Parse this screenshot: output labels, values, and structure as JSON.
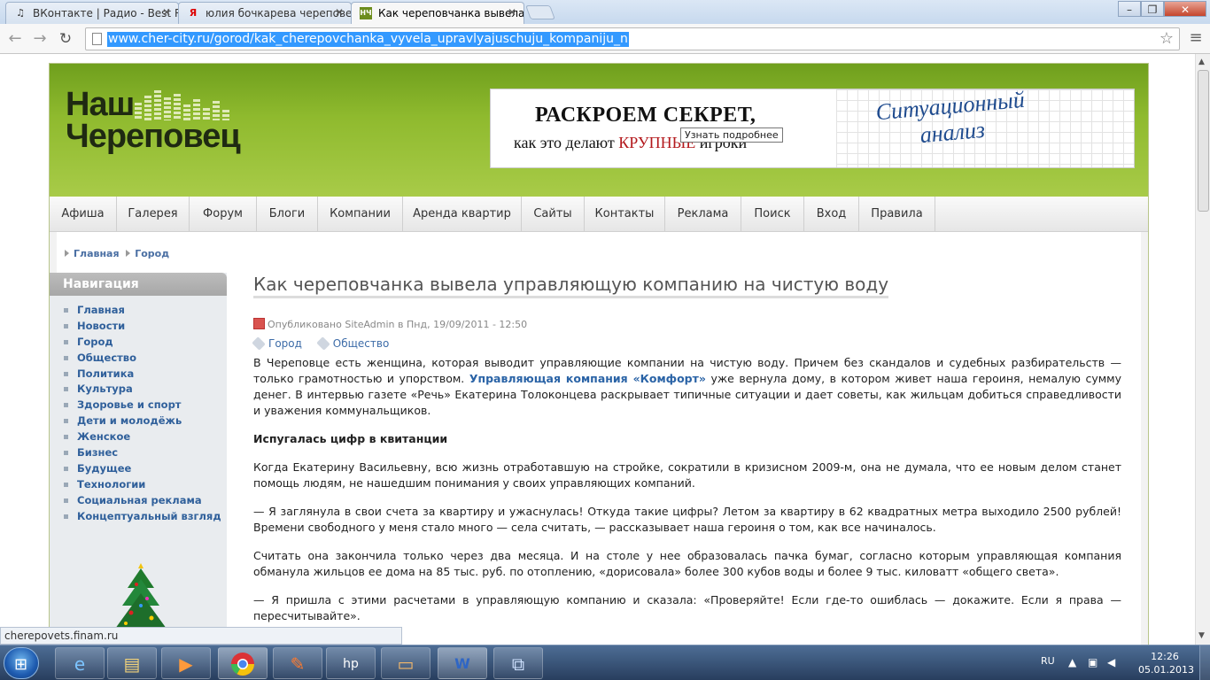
{
  "browser": {
    "tabs": [
      {
        "title": "ВКонтакте | Радио - Best Radio",
        "icon": "music-note-icon",
        "active": false
      },
      {
        "title": "юлия бочкарева череповец",
        "icon": "yandex-icon",
        "active": false
      },
      {
        "title": "Как череповчанка вывела управляющую",
        "icon": "site-favicon",
        "active": true
      }
    ],
    "url": "www.cher-city.ru/gorod/kak_cherepovchanka_vyvela_upravlyajuschuju_kompaniju_n",
    "status_url": "cherepovets.finam.ru"
  },
  "site": {
    "logo_line1": "Наш",
    "logo_line2": "Череповец",
    "banner": {
      "line1": "РАСКРОЕМ СЕКРЕТ,",
      "line2_prefix": "как это делают ",
      "line2_red": "КРУПНЫЕ",
      "line2_suffix": " игроки",
      "right_text": "Ситуационный анализ",
      "tooltip": "Узнать подробнее"
    },
    "menu": [
      "Афиша",
      "Галерея",
      "Форум",
      "Блоги",
      "Компании",
      "Аренда квартир",
      "Сайты",
      "Контакты",
      "Реклама",
      "Поиск",
      "Вход",
      "Правила"
    ],
    "breadcrumb": [
      "Главная",
      "Город"
    ],
    "nav_title": "Навигация",
    "nav_items": [
      "Главная",
      "Новости",
      "Город",
      "Общество",
      "Политика",
      "Культура",
      "Здоровье и спорт",
      "Дети и молодёжь",
      "Женское",
      "Бизнес",
      "Будущее",
      "Технологии",
      "Социальная реклама",
      "Концептуальный взгляд"
    ]
  },
  "article": {
    "title": "Как череповчанка вывела управляющую компанию на чистую воду",
    "meta_prefix": "Опубликовано ",
    "author": "SiteAdmin",
    "meta_suffix": " в Пнд, 19/09/2011 - 12:50",
    "tags": [
      "Город",
      "Общество"
    ],
    "p1_a": "В Череповце есть женщина, которая выводит управляющие компании на чистую воду. Причем без скандалов и судебных разбирательств — только грамотностью и упорством. ",
    "p1_link": "Управляющая компания «Комфорт»",
    "p1_b": " уже вернула дому, в котором живет наша героиня, немалую сумму денег. В интервью газете «Речь» Екатерина Толоконцева раскрывает типичные ситуации и дает советы, как жильцам добиться справедливости и уважения коммунальщиков.",
    "subheading": "Испугалась цифр в квитанции",
    "p2": "Когда Екатерину Васильевну, всю жизнь отработавшую на стройке, сократили в кризисном 2009-м, она не думала, что ее новым делом станет помощь людям, не нашедшим понимания у своих управляющих компаний.",
    "p3": "— Я заглянула в свои счета за квартиру и ужаснулась! Откуда такие цифры? Летом за квартиру в 62 квадратных метра выходило 2500 рублей! Времени свободного у меня стало много — села считать, — рассказывает наша героиня о том, как все начиналось.",
    "p4": "Считать она закончила только через два месяца. И на столе у нее образовалась пачка бумаг, согласно которым управляющая компания обманула жильцов ее дома на 85 тыс. руб. по отоплению, «дорисовала» более 300 кубов воды и более 9 тыс. киловатт «общего света».",
    "p5": "— Я пришла с этими расчетами в управляющую компанию и сказала: «Проверяйте! Если где-то ошиблась — докажите. Если я права — пересчитывайте»."
  },
  "taskbar": {
    "apps": [
      "internet-explorer-icon",
      "file-explorer-icon",
      "media-player-icon",
      "chrome-icon",
      "paint-icon",
      "hp-icon",
      "scanner-icon",
      "word-icon",
      "window-icon"
    ],
    "lang": "RU",
    "time": "12:26",
    "date": "05.01.2013"
  },
  "colors": {
    "header_green": "#8fba2e",
    "link_blue": "#2a63a6",
    "selection_blue": "#3399ff"
  }
}
